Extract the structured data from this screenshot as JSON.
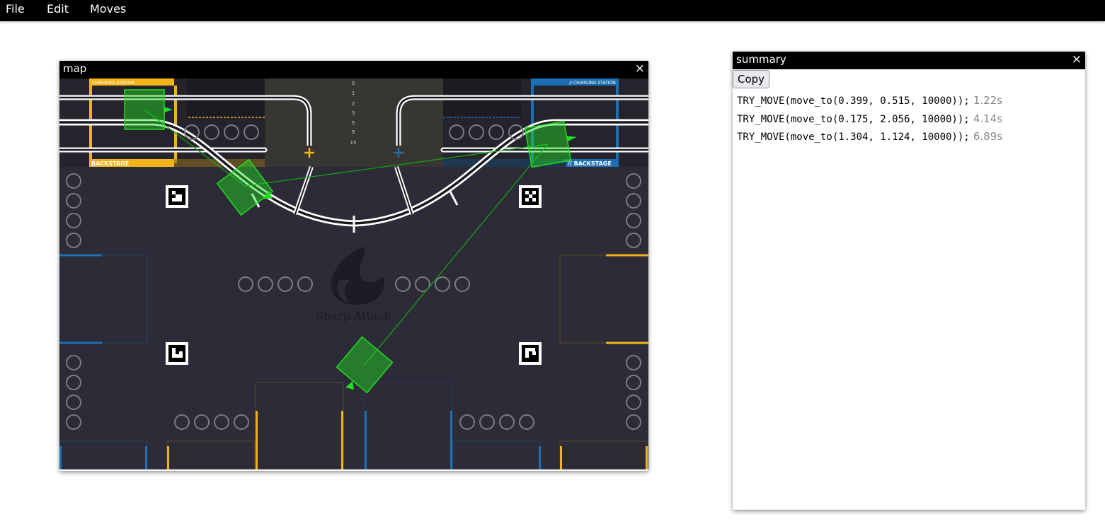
{
  "menubar": {
    "items": [
      {
        "label": "File"
      },
      {
        "label": "Edit"
      },
      {
        "label": "Moves"
      }
    ]
  },
  "map_window": {
    "title": "map",
    "close_glyph": "×",
    "field_labels": {
      "left_top": "CHARGING STATION",
      "right_top": "// CHARGING STATION",
      "left_bottom": "BACKSTAGE",
      "right_bottom": "// BACKSTAGE",
      "logo_text": "Sharp Attack"
    },
    "scale_ticks": [
      "0",
      "1",
      "2",
      "3",
      "5",
      "9",
      "15"
    ],
    "colors": {
      "field": "#2c2b37",
      "yellow": "#f1b319",
      "blue": "#1d6fb2",
      "robot": "#22dd22",
      "track": "#ffffff"
    }
  },
  "summary_window": {
    "title": "summary",
    "close_glyph": "×",
    "copy_label": "Copy",
    "moves": [
      {
        "code": "TRY_MOVE(move_to(0.399, 0.515, 10000));",
        "time": "1.22s"
      },
      {
        "code": "TRY_MOVE(move_to(0.175, 2.056, 10000));",
        "time": "4.14s"
      },
      {
        "code": "TRY_MOVE(move_to(1.304, 1.124, 10000));",
        "time": "6.89s"
      }
    ]
  }
}
